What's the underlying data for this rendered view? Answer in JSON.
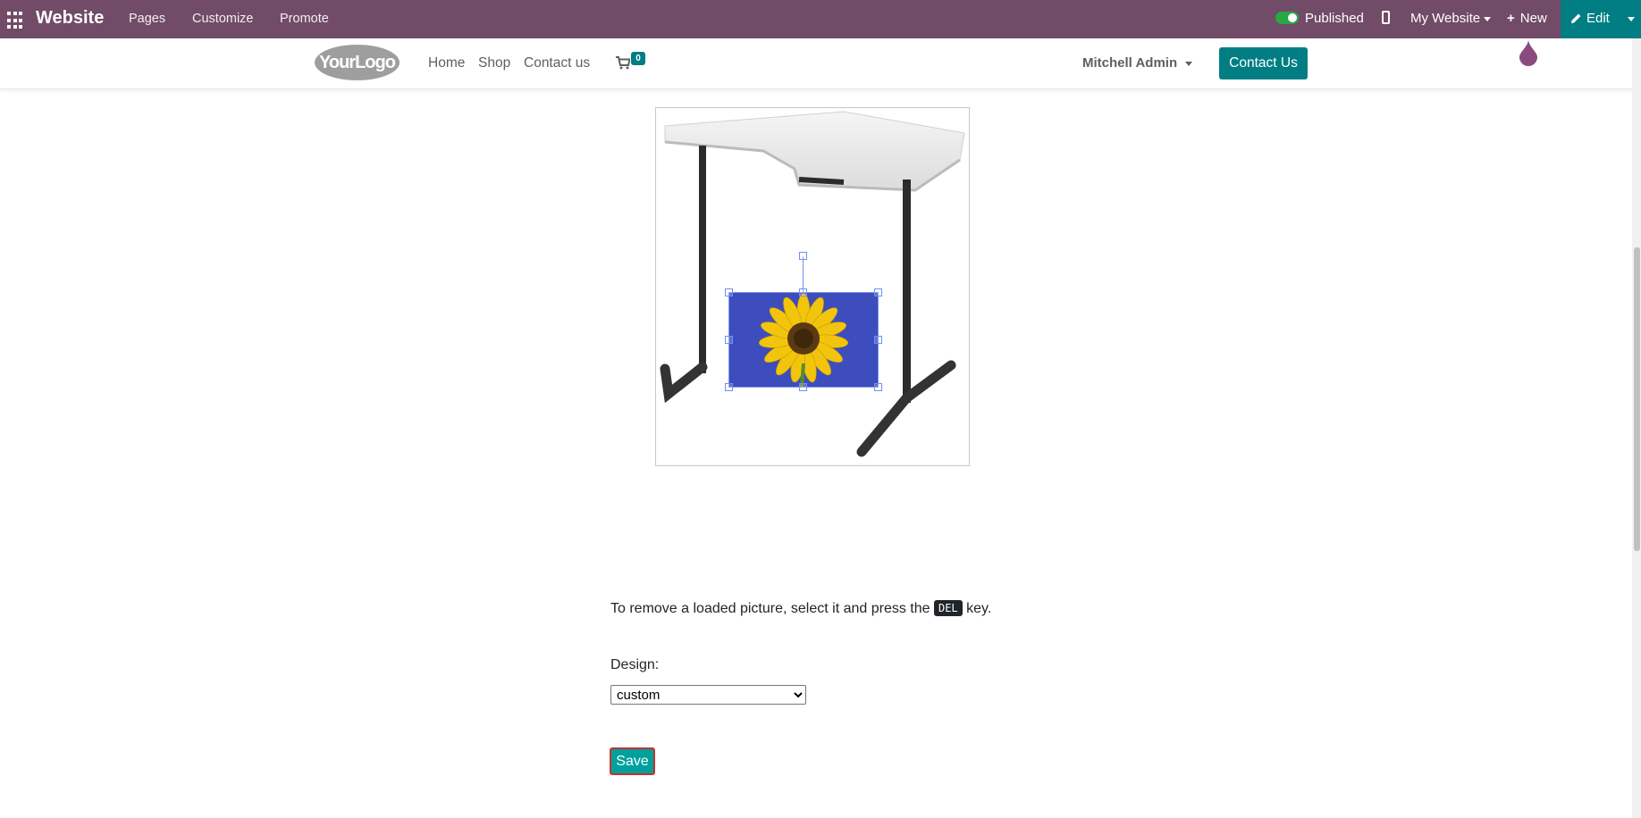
{
  "topbar": {
    "brand": "Website",
    "menu": [
      "Pages",
      "Customize",
      "Promote"
    ],
    "published_label": "Published",
    "website_label": "My Website",
    "new_label": "New",
    "edit_label": "Edit",
    "color": "#714b67"
  },
  "navbar": {
    "logo_text": "YourLogo",
    "links": [
      "Home",
      "Shop",
      "Contact us"
    ],
    "cart_count": "0",
    "user_name": "Mitchell Admin",
    "contact_button": "Contact Us",
    "accent": "#017e84"
  },
  "content": {
    "info_text_before": "To remove a loaded picture, select it and press the",
    "info_key": "DEL",
    "info_text_after": "key.",
    "design_label": "Design:",
    "design_options": [
      "custom"
    ],
    "design_selected": "custom",
    "save_label": "Save"
  }
}
